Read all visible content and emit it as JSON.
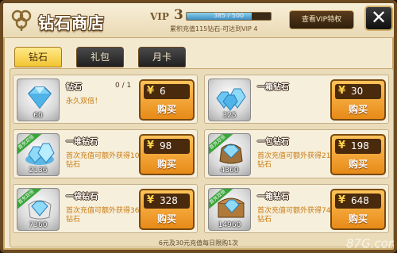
{
  "header": {
    "title": "钻石商店",
    "vip_label": "VIP",
    "vip_level": "3",
    "vip_progress_text": "385 / 500",
    "vip_progress_fraction": 0.77,
    "vip_note": "累积充值115钻石-可达到VIP 4",
    "view_vip_label": "查看VIP特权",
    "close_label": "✕"
  },
  "tabs": [
    {
      "label": "钻石",
      "active": true
    },
    {
      "label": "礼包",
      "active": false
    },
    {
      "label": "月卡",
      "active": false
    }
  ],
  "items": [
    {
      "name": "钻石",
      "limit": "0 / 1",
      "desc": "永久双倍！",
      "count": "60",
      "price": "6",
      "buy": "购买",
      "ribbon": ""
    },
    {
      "name": "一箱钻石",
      "limit": "",
      "desc": "",
      "count": "325",
      "price": "30",
      "buy": "购买",
      "ribbon": ""
    },
    {
      "name": "一堆钻石",
      "limit": "",
      "desc": "首次充值可额外获得1068钻石",
      "count": "2136",
      "price": "98",
      "buy": "购买",
      "ribbon": "首充双倍"
    },
    {
      "name": "一包钻石",
      "limit": "",
      "desc": "首次充值可额外获得2180钻石",
      "count": "4360",
      "price": "198",
      "buy": "购买",
      "ribbon": "首充双倍"
    },
    {
      "name": "一袋钻石",
      "limit": "",
      "desc": "首次充值可额外获得3680钻石",
      "count": "7360",
      "price": "328",
      "buy": "购买",
      "ribbon": "首充双倍"
    },
    {
      "name": "一箱钻石",
      "limit": "",
      "desc": "首次充值可额外获得7480钻石",
      "count": "14960",
      "price": "648",
      "buy": "购买",
      "ribbon": "首充双倍"
    }
  ],
  "footer": {
    "note": "6元及30元充值每日限购1次",
    "watermark": "87G.com"
  },
  "colors": {
    "accent_gold": "#f2c431",
    "buy_orange": "#e78a18",
    "frame_brown": "#6b4a21"
  }
}
